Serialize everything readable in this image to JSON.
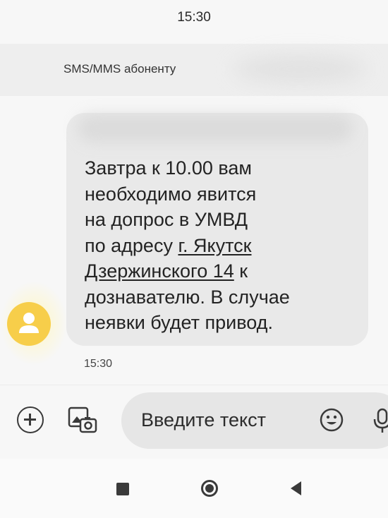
{
  "status_bar": {
    "time": "15:30"
  },
  "header": {
    "recipient": "SMS/MMS абоненту"
  },
  "message": {
    "line_1": "Завтра к 10.00 вам",
    "line_2": "необходимо явится",
    "line_3": "на допрос в УМВД",
    "line_4_prefix": "по адресу ",
    "line_4_link": "г. Якутск",
    "line_5_link": "Дзержинского 14",
    "line_5_suffix": " к",
    "line_6": "дознавателю. В случае",
    "line_7": "неявки будет привод.",
    "time": "15:30"
  },
  "composer": {
    "placeholder": "Введите текст",
    "add_icon": "plus-circle-icon",
    "attach_icon": "gallery-icon",
    "emoji_icon": "emoji-icon",
    "mic_icon": "microphone-icon"
  },
  "avatar": {
    "icon": "person-icon",
    "color": "#f7ce4a"
  },
  "nav": {
    "recents_icon": "recents-icon",
    "home_icon": "home-icon",
    "back_icon": "back-icon"
  }
}
